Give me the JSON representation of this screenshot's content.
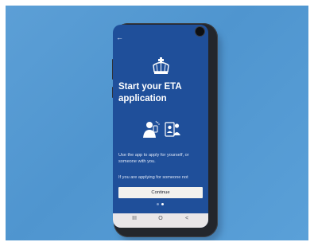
{
  "screen": {
    "back_icon": "arrow-left-icon",
    "logo_icon": "royal-crown-icon",
    "title": "Start your ETA application",
    "illustration_icons": [
      "person-with-phone-icon",
      "two-person-id-icon"
    ],
    "paragraph1": "Use the app to apply for yourself, or someone with you.",
    "paragraph2": "If you are applying for someone not",
    "continue_label": "Continue",
    "pagination": {
      "pages": 2,
      "active": 2
    }
  },
  "nav_bar": {
    "recents_glyph": "III",
    "home_glyph": "O",
    "back_glyph": "<"
  },
  "colors": {
    "screen_bg": "#1f4f9a",
    "button_bg": "#f3f2ee",
    "background": "#5c9fd6"
  }
}
